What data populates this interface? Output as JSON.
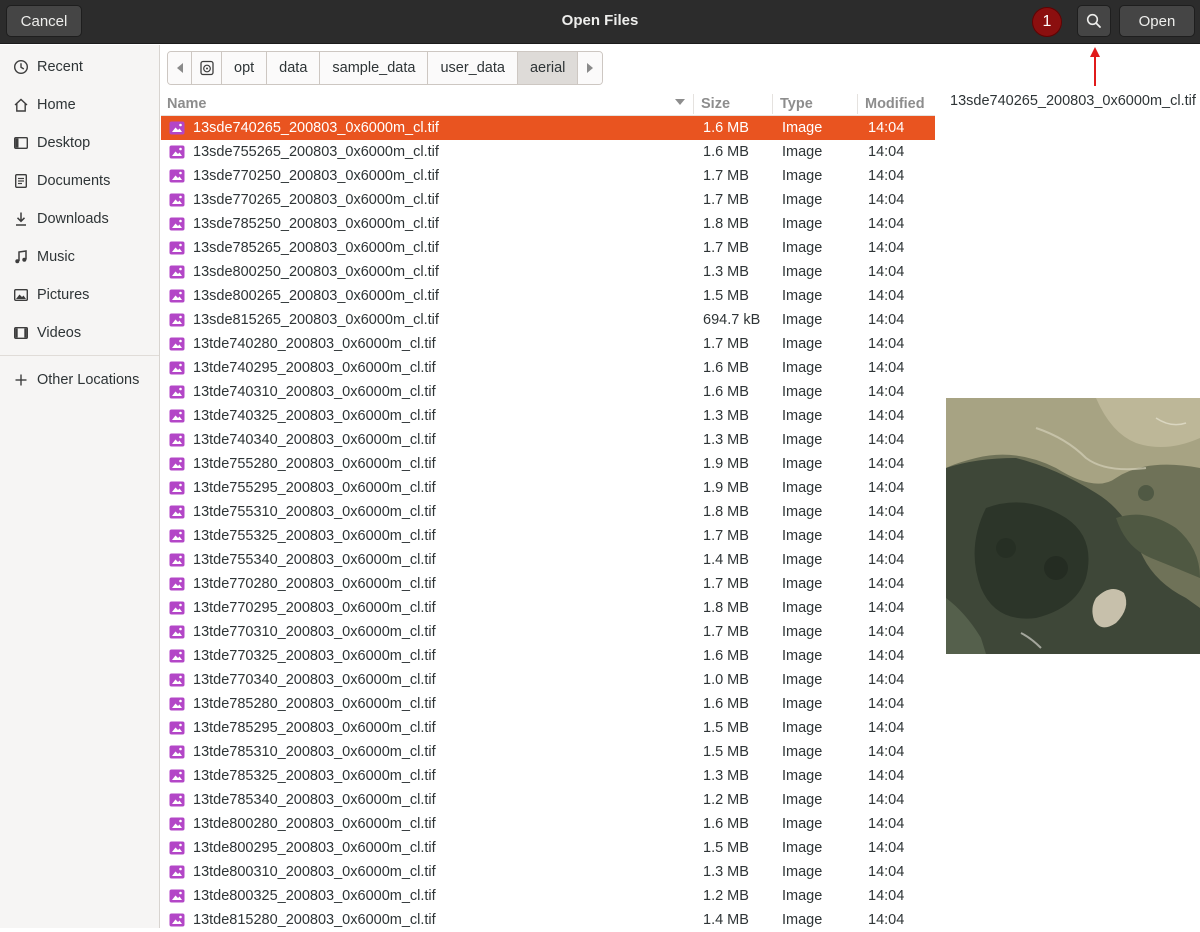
{
  "header": {
    "title": "Open Files",
    "cancel_label": "Cancel",
    "open_label": "Open",
    "annotation_number": "1"
  },
  "sidebar": {
    "items": [
      {
        "label": "Recent",
        "icon": "clock-icon"
      },
      {
        "label": "Home",
        "icon": "home-icon"
      },
      {
        "label": "Desktop",
        "icon": "desktop-icon"
      },
      {
        "label": "Documents",
        "icon": "document-icon"
      },
      {
        "label": "Downloads",
        "icon": "download-icon"
      },
      {
        "label": "Music",
        "icon": "music-icon"
      },
      {
        "label": "Pictures",
        "icon": "picture-icon"
      },
      {
        "label": "Videos",
        "icon": "video-icon"
      }
    ],
    "other_locations_label": "Other Locations"
  },
  "pathbar": {
    "segments": [
      "opt",
      "data",
      "sample_data",
      "user_data",
      "aerial"
    ],
    "active_segment": "aerial"
  },
  "filelist": {
    "columns": {
      "name": "Name",
      "size": "Size",
      "type": "Type",
      "modified": "Modified"
    },
    "files": [
      {
        "name": "13sde740265_200803_0x6000m_cl.tif",
        "size": "1.6 MB",
        "type": "Image",
        "modified": "14:04",
        "selected": true
      },
      {
        "name": "13sde755265_200803_0x6000m_cl.tif",
        "size": "1.6 MB",
        "type": "Image",
        "modified": "14:04"
      },
      {
        "name": "13sde770250_200803_0x6000m_cl.tif",
        "size": "1.7 MB",
        "type": "Image",
        "modified": "14:04"
      },
      {
        "name": "13sde770265_200803_0x6000m_cl.tif",
        "size": "1.7 MB",
        "type": "Image",
        "modified": "14:04"
      },
      {
        "name": "13sde785250_200803_0x6000m_cl.tif",
        "size": "1.8 MB",
        "type": "Image",
        "modified": "14:04"
      },
      {
        "name": "13sde785265_200803_0x6000m_cl.tif",
        "size": "1.7 MB",
        "type": "Image",
        "modified": "14:04"
      },
      {
        "name": "13sde800250_200803_0x6000m_cl.tif",
        "size": "1.3 MB",
        "type": "Image",
        "modified": "14:04"
      },
      {
        "name": "13sde800265_200803_0x6000m_cl.tif",
        "size": "1.5 MB",
        "type": "Image",
        "modified": "14:04"
      },
      {
        "name": "13sde815265_200803_0x6000m_cl.tif",
        "size": "694.7 kB",
        "type": "Image",
        "modified": "14:04"
      },
      {
        "name": "13tde740280_200803_0x6000m_cl.tif",
        "size": "1.7 MB",
        "type": "Image",
        "modified": "14:04"
      },
      {
        "name": "13tde740295_200803_0x6000m_cl.tif",
        "size": "1.6 MB",
        "type": "Image",
        "modified": "14:04"
      },
      {
        "name": "13tde740310_200803_0x6000m_cl.tif",
        "size": "1.6 MB",
        "type": "Image",
        "modified": "14:04"
      },
      {
        "name": "13tde740325_200803_0x6000m_cl.tif",
        "size": "1.3 MB",
        "type": "Image",
        "modified": "14:04"
      },
      {
        "name": "13tde740340_200803_0x6000m_cl.tif",
        "size": "1.3 MB",
        "type": "Image",
        "modified": "14:04"
      },
      {
        "name": "13tde755280_200803_0x6000m_cl.tif",
        "size": "1.9 MB",
        "type": "Image",
        "modified": "14:04"
      },
      {
        "name": "13tde755295_200803_0x6000m_cl.tif",
        "size": "1.9 MB",
        "type": "Image",
        "modified": "14:04"
      },
      {
        "name": "13tde755310_200803_0x6000m_cl.tif",
        "size": "1.8 MB",
        "type": "Image",
        "modified": "14:04"
      },
      {
        "name": "13tde755325_200803_0x6000m_cl.tif",
        "size": "1.7 MB",
        "type": "Image",
        "modified": "14:04"
      },
      {
        "name": "13tde755340_200803_0x6000m_cl.tif",
        "size": "1.4 MB",
        "type": "Image",
        "modified": "14:04"
      },
      {
        "name": "13tde770280_200803_0x6000m_cl.tif",
        "size": "1.7 MB",
        "type": "Image",
        "modified": "14:04"
      },
      {
        "name": "13tde770295_200803_0x6000m_cl.tif",
        "size": "1.8 MB",
        "type": "Image",
        "modified": "14:04"
      },
      {
        "name": "13tde770310_200803_0x6000m_cl.tif",
        "size": "1.7 MB",
        "type": "Image",
        "modified": "14:04"
      },
      {
        "name": "13tde770325_200803_0x6000m_cl.tif",
        "size": "1.6 MB",
        "type": "Image",
        "modified": "14:04"
      },
      {
        "name": "13tde770340_200803_0x6000m_cl.tif",
        "size": "1.0 MB",
        "type": "Image",
        "modified": "14:04"
      },
      {
        "name": "13tde785280_200803_0x6000m_cl.tif",
        "size": "1.6 MB",
        "type": "Image",
        "modified": "14:04"
      },
      {
        "name": "13tde785295_200803_0x6000m_cl.tif",
        "size": "1.5 MB",
        "type": "Image",
        "modified": "14:04"
      },
      {
        "name": "13tde785310_200803_0x6000m_cl.tif",
        "size": "1.5 MB",
        "type": "Image",
        "modified": "14:04"
      },
      {
        "name": "13tde785325_200803_0x6000m_cl.tif",
        "size": "1.3 MB",
        "type": "Image",
        "modified": "14:04"
      },
      {
        "name": "13tde785340_200803_0x6000m_cl.tif",
        "size": "1.2 MB",
        "type": "Image",
        "modified": "14:04"
      },
      {
        "name": "13tde800280_200803_0x6000m_cl.tif",
        "size": "1.6 MB",
        "type": "Image",
        "modified": "14:04"
      },
      {
        "name": "13tde800295_200803_0x6000m_cl.tif",
        "size": "1.5 MB",
        "type": "Image",
        "modified": "14:04"
      },
      {
        "name": "13tde800310_200803_0x6000m_cl.tif",
        "size": "1.3 MB",
        "type": "Image",
        "modified": "14:04"
      },
      {
        "name": "13tde800325_200803_0x6000m_cl.tif",
        "size": "1.2 MB",
        "type": "Image",
        "modified": "14:04"
      },
      {
        "name": "13tde815280_200803_0x6000m_cl.tif",
        "size": "1.4 MB",
        "type": "Image",
        "modified": "14:04"
      }
    ]
  },
  "preview": {
    "filename": "13sde740265_200803_0x6000m_cl.tif"
  },
  "colors": {
    "header_bg": "#2c2c2c",
    "selection": "#e95420",
    "file_icon": "#b346c7",
    "badge": "#8b0f0f",
    "annotation_arrow": "#e01b1b"
  }
}
